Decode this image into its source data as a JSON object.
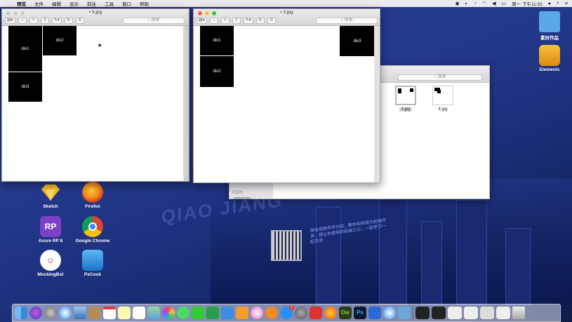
{
  "menubar": {
    "app": "预览",
    "items": [
      "文件",
      "编辑",
      "显示",
      "前往",
      "工具",
      "窗口",
      "帮助"
    ],
    "clock": "周一 下午11:32"
  },
  "desktop_icons": [
    {
      "label": "素材作品",
      "icon": "folder-icon",
      "color": "#5aa8e8"
    },
    {
      "label": "Elements",
      "icon": "elements-drive-icon",
      "color": "#f0a020"
    },
    {
      "label": "Sketch",
      "icon": "sketch-icon",
      "color": "#f5b82a"
    },
    {
      "label": "Firefox",
      "icon": "firefox-icon",
      "color": "#e8631e"
    },
    {
      "label": "Axure RP 8",
      "icon": "axure-icon",
      "color": "#7c3fc8"
    },
    {
      "label": "Google Chrome",
      "icon": "chrome-icon",
      "color": "#2f8f3a"
    },
    {
      "label": "MockingBot",
      "icon": "mockingbot-icon",
      "color": "#ffffff"
    },
    {
      "label": "PxCook",
      "icon": "pxcook-icon",
      "color": "#2a8bd8"
    }
  ],
  "desktop_art": {
    "headline": "QIAO JIANG",
    "promo_text": "微信视频号早代码，教你如何成为前端开发，想让你使用的前端之父，一起学习一起交流"
  },
  "window_left": {
    "title": "5.jpg",
    "search_placeholder": "搜索",
    "blocks": [
      "div1",
      "div2",
      "div3"
    ]
  },
  "window_right": {
    "title": "3.jpg",
    "search_placeholder": "搜索",
    "blocks": [
      "div1",
      "div2",
      "div3"
    ]
  },
  "finder": {
    "search_placeholder": "搜索",
    "sidebar": {
      "section": "共享的",
      "items": [
        "Elements",
        "smbshare"
      ]
    },
    "files": [
      {
        "name": "3.jpg",
        "selected": true
      },
      {
        "name": "4.jpg",
        "selected": false
      }
    ]
  },
  "dock": {
    "apps": [
      "Finder",
      "Siri",
      "Launchpad",
      "Safari",
      "Preview",
      "Contacts",
      "Calendar",
      "Notes",
      "Reminders",
      "Maps",
      "Photos",
      "Messages",
      "FaceTime",
      "Numbers",
      "Keynote",
      "Pages",
      "iTunes",
      "iBooks",
      "App Store",
      "System Preferences",
      "XMind",
      "Firefox",
      "Dreamweaver",
      "Photoshop",
      "Axure",
      "PxCook",
      "Safari-2"
    ],
    "badge": "1"
  }
}
